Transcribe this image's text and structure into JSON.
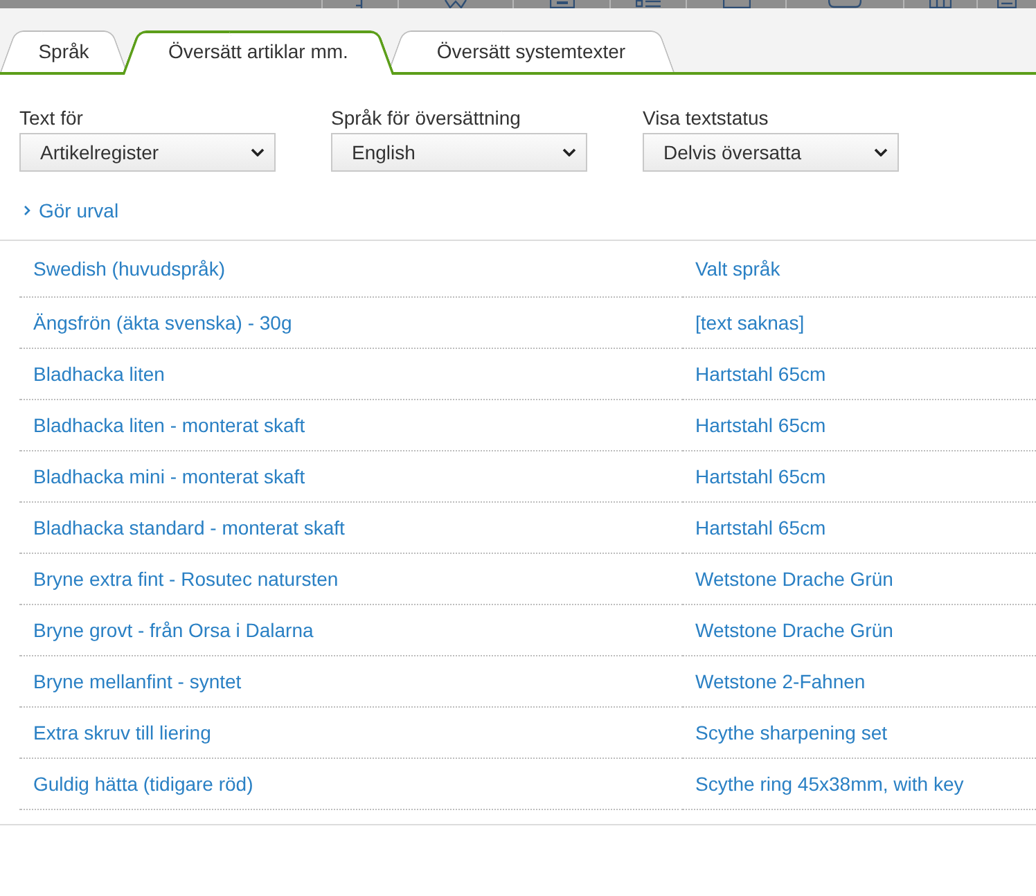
{
  "tabs": [
    {
      "label": "Språk",
      "selected": false
    },
    {
      "label": "Översätt artiklar mm.",
      "selected": true
    },
    {
      "label": "Översätt systemtexter",
      "selected": false
    }
  ],
  "filters": [
    {
      "label": "Text för",
      "value": "Artikelregister"
    },
    {
      "label": "Språk för översättning",
      "value": "English"
    },
    {
      "label": "Visa textstatus",
      "value": "Delvis översatta"
    }
  ],
  "selection_toggle": {
    "label": "Gör urval",
    "expanded": false
  },
  "table": {
    "columns": [
      "Swedish (huvudspråk)",
      "Valt språk"
    ],
    "rows": [
      [
        "Ängsfrön (äkta svenska) - 30g",
        "[text saknas]"
      ],
      [
        "Bladhacka liten",
        "Hartstahl 65cm"
      ],
      [
        "Bladhacka liten - monterat skaft",
        "Hartstahl 65cm"
      ],
      [
        "Bladhacka mini - monterat skaft",
        "Hartstahl 65cm"
      ],
      [
        "Bladhacka standard - monterat skaft",
        "Hartstahl 65cm"
      ],
      [
        "Bryne extra fint - Rosutec natursten",
        "Wetstone Drache Grün"
      ],
      [
        "Bryne grovt - från Orsa i Dalarna",
        "Wetstone Drache Grün"
      ],
      [
        "Bryne mellanfint - syntet",
        "Wetstone 2-Fahnen"
      ],
      [
        "Extra skruv till liering",
        "Scythe sharpening set"
      ],
      [
        "Guldig hätta (tidigare röd)",
        "Scythe ring 45x38mm, with key"
      ]
    ]
  }
}
